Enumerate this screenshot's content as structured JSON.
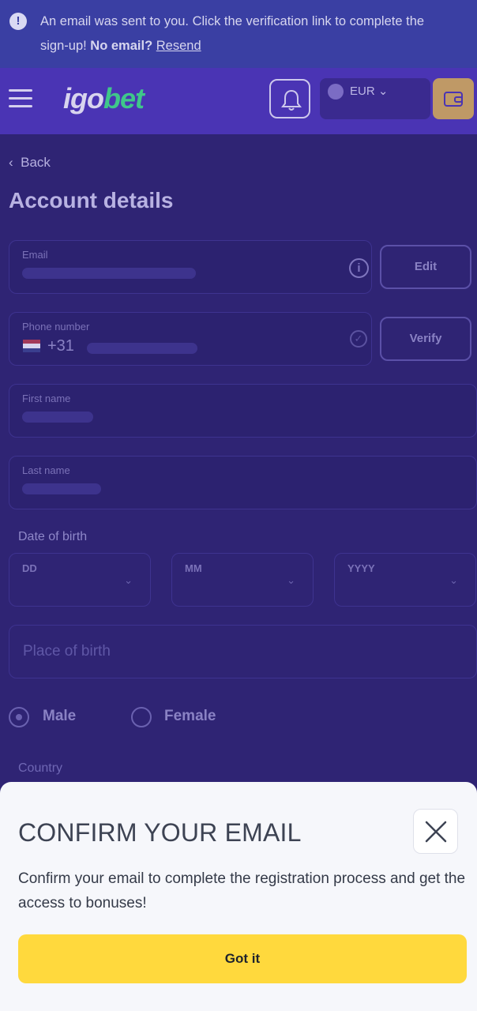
{
  "banner": {
    "text": "An email was sent to you. Click the verification link to complete the sign-up!",
    "no_email": "No email?",
    "resend": "Resend"
  },
  "header": {
    "logo_part1": "igo",
    "logo_part2": "bet",
    "currency": "EUR"
  },
  "form": {
    "back": "Back",
    "title": "Account details",
    "email_label": "Email",
    "edit": "Edit",
    "phone_label": "Phone number",
    "dial_code": "+31",
    "verify": "Verify",
    "first_name_label": "First name",
    "last_name_label": "Last name",
    "dob_label": "Date of birth",
    "dd": "DD",
    "mm": "MM",
    "yyyy": "YYYY",
    "place_placeholder": "Place of birth",
    "male": "Male",
    "female": "Female",
    "country_label": "Country"
  },
  "modal": {
    "title": "CONFIRM YOUR EMAIL",
    "body": "Confirm your email to complete the registration process and get the access to bonuses!",
    "button": "Got it"
  },
  "colors": {
    "accent_yellow": "#ffd93d",
    "header_purple": "#4a34b4",
    "banner_blue": "#3a3fa3",
    "logo_green": "#3fc78a"
  },
  "icons": [
    "info-icon",
    "hamburger-icon",
    "bell-icon",
    "wallet-icon",
    "check-circle-icon",
    "chevron-down-icon",
    "close-icon",
    "chevron-left-icon"
  ]
}
